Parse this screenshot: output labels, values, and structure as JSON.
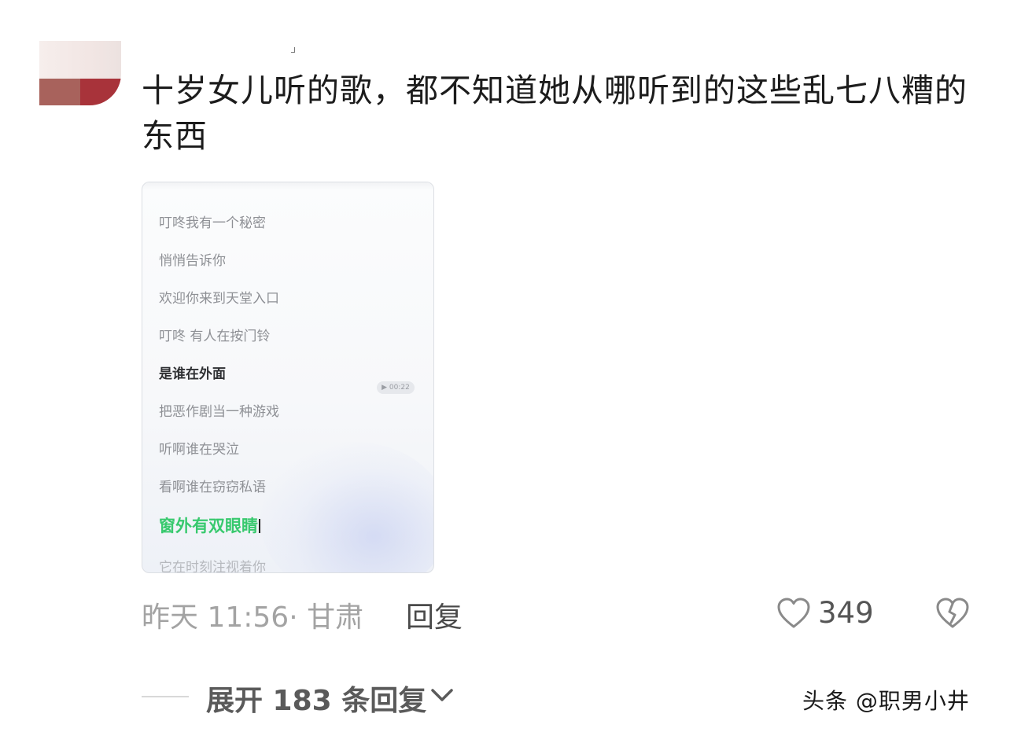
{
  "comment": {
    "text": "十岁女儿听的歌，都不知道她从哪听到的这些乱七八糟的东西"
  },
  "lyrics": {
    "lines": [
      "叮咚我有一个秘密",
      "悄悄告诉你",
      "欢迎你来到天堂入口",
      "叮咚 有人在按门铃",
      "是谁在外面",
      "把恶作剧当一种游戏",
      "听啊谁在哭泣",
      "看啊谁在窃窃私语",
      "窗外有双眼睛",
      "它在时刻注视着你"
    ],
    "audio_duration": "00:22"
  },
  "meta": {
    "time_location": "昨天 11:56· 甘肃",
    "reply_label": "回复",
    "like_count": "349"
  },
  "replies": {
    "expand_label": "展开 183 条回复"
  },
  "watermark": "头条 @职男小井",
  "colors": {
    "active_lyric": "#38c96e",
    "muted_text": "#a3a3a3"
  },
  "icons": {
    "like": "heart-outline-icon",
    "dislike": "broken-heart-icon",
    "expand": "chevron-down-icon"
  }
}
